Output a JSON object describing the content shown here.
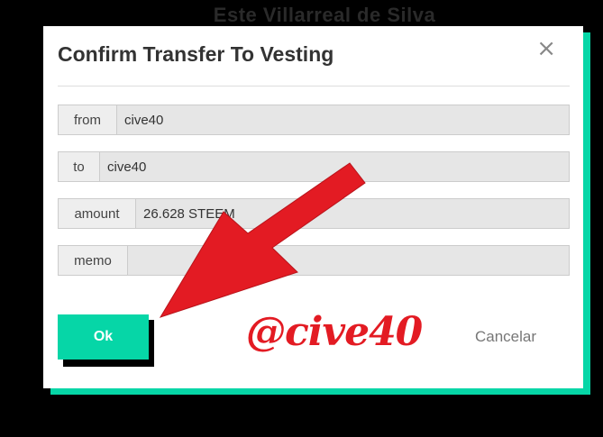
{
  "background": {
    "title": "Este Villarreal de Silva"
  },
  "modal": {
    "title": "Confirm Transfer To Vesting",
    "close_symbol": "×",
    "fields": [
      {
        "label": "from",
        "value": "cive40"
      },
      {
        "label": "to",
        "value": "cive40"
      },
      {
        "label": "amount",
        "value": "26.628 STEEM"
      },
      {
        "label": "memo",
        "value": ""
      }
    ],
    "ok_label": "Ok",
    "cancel_label": "Cancelar"
  },
  "watermark": "@cive40",
  "colors": {
    "accent": "#06d6a7",
    "arrow": "#e31b23"
  }
}
